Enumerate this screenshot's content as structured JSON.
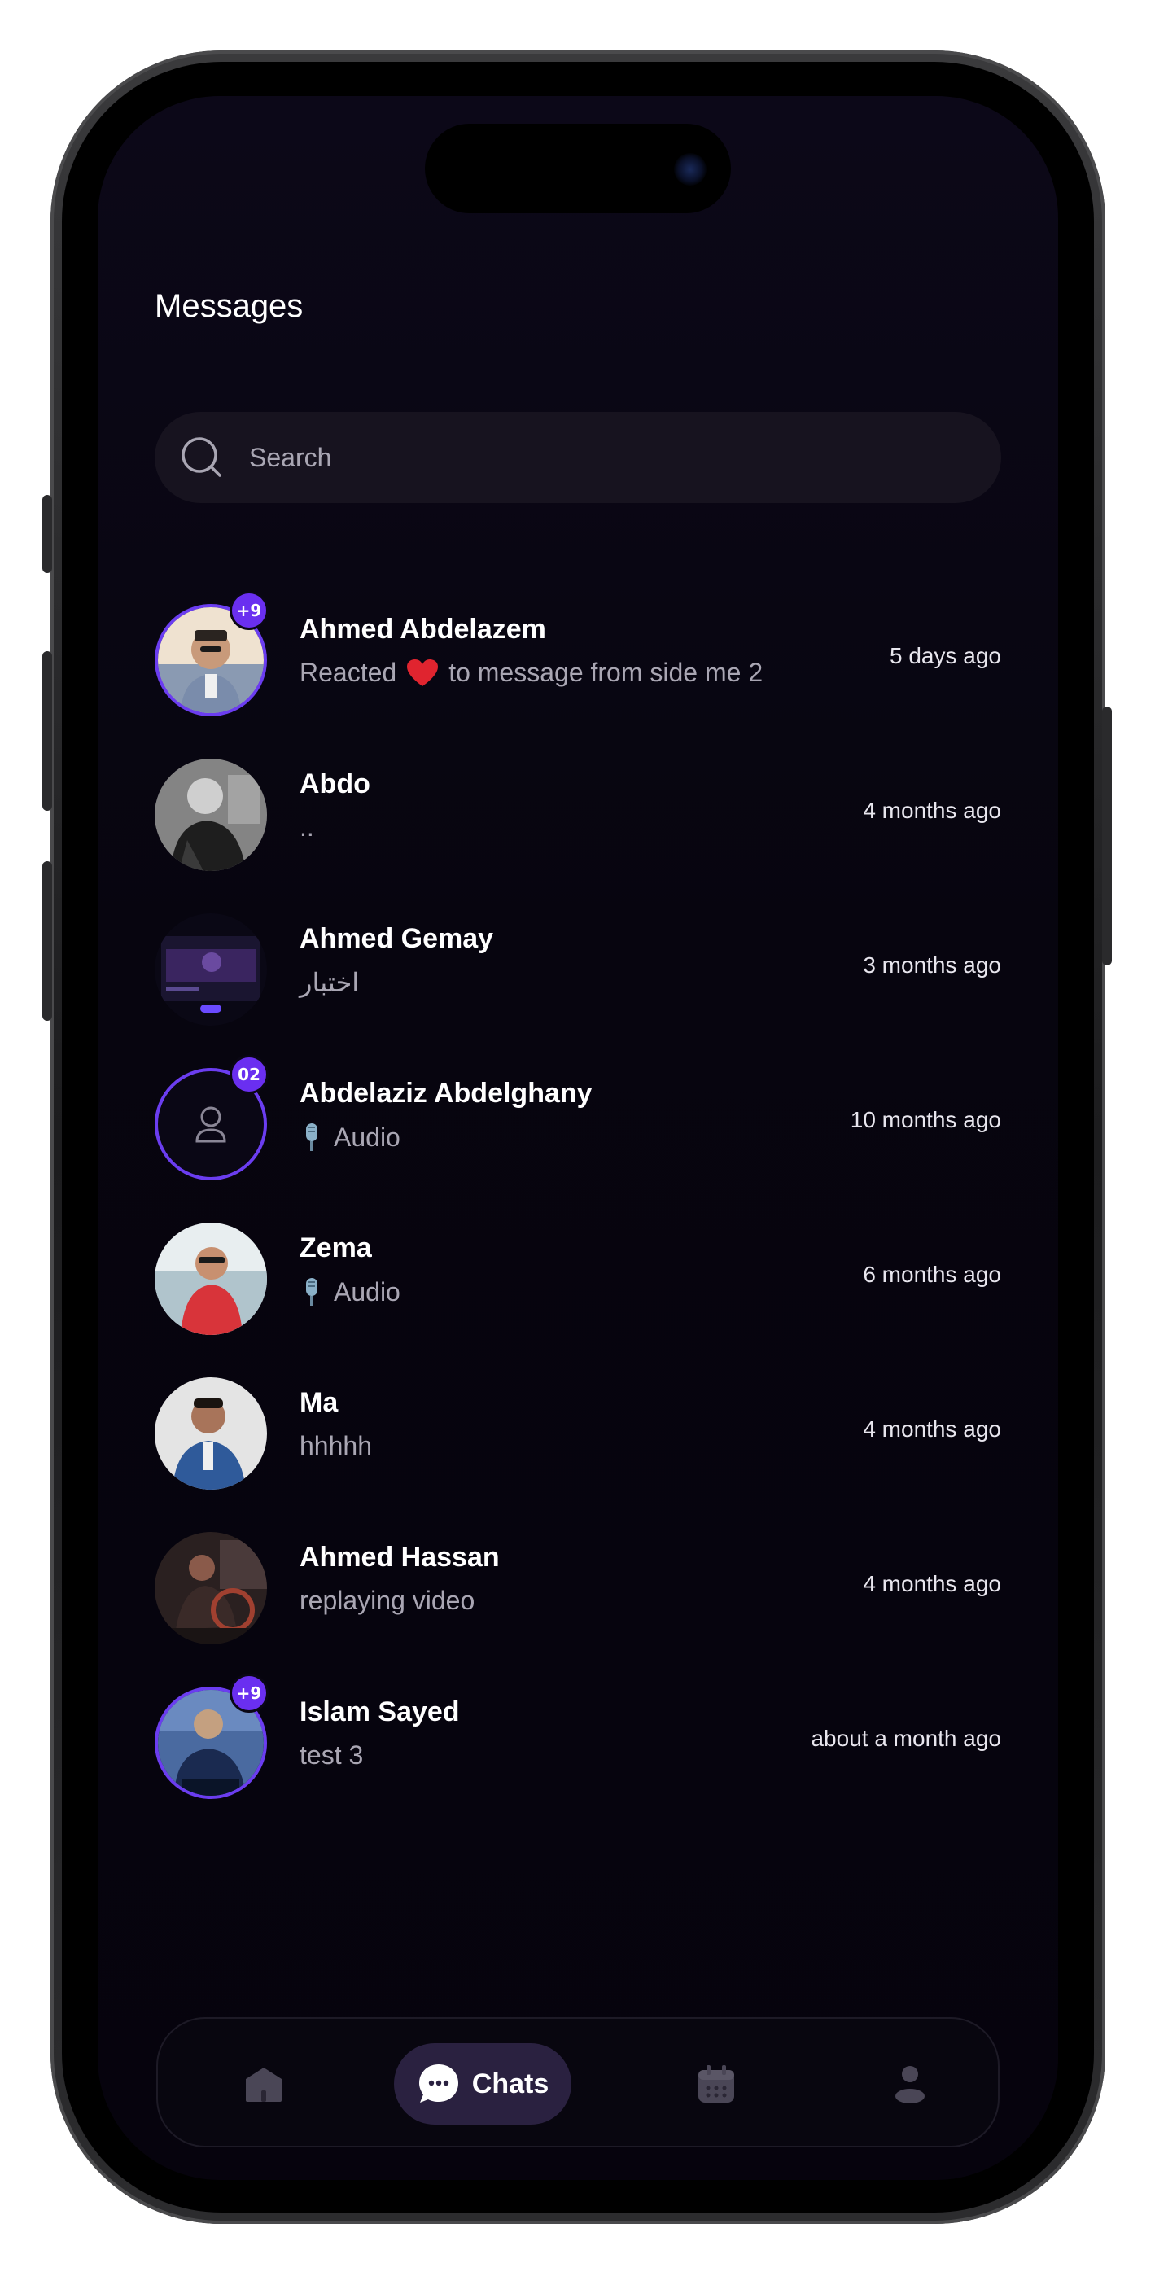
{
  "header": {
    "title": "Messages"
  },
  "search": {
    "placeholder": "Search"
  },
  "chats": [
    {
      "name": "Ahmed Abdelazem",
      "preview_prefix": "Reacted",
      "preview_emoji": "❤️",
      "preview": "to message from side me 2",
      "time": "5 days ago",
      "badge": "+9",
      "avatar": "photo",
      "avatar_colors": [
        "#e9d9c4",
        "#7a8aa0",
        "#3a2f2a"
      ]
    },
    {
      "name": "Abdo",
      "preview": "..",
      "time": "4 months ago",
      "badge": "",
      "avatar": "photo",
      "avatar_colors": [
        "#8a8a8a",
        "#2a2a2a",
        "#cfcfcf"
      ]
    },
    {
      "name": "Ahmed Gemay",
      "preview": "اختبار",
      "time": "3 months ago",
      "badge": "",
      "avatar": "screenshot",
      "avatar_colors": [
        "#1a1530",
        "#4a2a7a",
        "#0a0815"
      ]
    },
    {
      "name": "Abdelaziz Abdelghany",
      "preview_icon": "microphone-icon",
      "preview": "Audio",
      "time": "10 months ago",
      "badge": "02",
      "avatar": "placeholder",
      "avatar_colors": [
        "#0a0715",
        "#5f3bd8"
      ]
    },
    {
      "name": "Zema",
      "preview_icon": "microphone-icon",
      "preview": "Audio",
      "time": "6 months ago",
      "badge": "",
      "avatar": "photo",
      "avatar_colors": [
        "#e8eef0",
        "#d83a3a",
        "#9ab0c0"
      ]
    },
    {
      "name": "Ma",
      "preview": "hhhhh",
      "time": "4 months ago",
      "badge": "",
      "avatar": "photo",
      "avatar_colors": [
        "#dcdcdc",
        "#2f5a9a",
        "#5a3a2a"
      ]
    },
    {
      "name": "Ahmed Hassan",
      "preview": "replaying video",
      "time": "4 months ago",
      "badge": "",
      "avatar": "photo",
      "avatar_colors": [
        "#3a2a2a",
        "#8a5a4a",
        "#1a1414"
      ]
    },
    {
      "name": "Islam Sayed",
      "preview": "test 3",
      "time": "about a month ago",
      "badge": "+9",
      "avatar": "photo",
      "avatar_colors": [
        "#4a6aa0",
        "#1a2a50",
        "#c4a080"
      ]
    }
  ],
  "nav": {
    "items": [
      {
        "icon": "home-icon"
      },
      {
        "icon": "chat-bubble-icon",
        "label": "Chats",
        "active": true
      },
      {
        "icon": "calendar-icon"
      },
      {
        "icon": "profile-icon"
      }
    ]
  },
  "colors": {
    "accent": "#6a2ff0",
    "background": "#07050f",
    "search_bg": "#17131f",
    "muted_text": "#a9a6b3",
    "nav_active_bg": "#2a2140"
  }
}
